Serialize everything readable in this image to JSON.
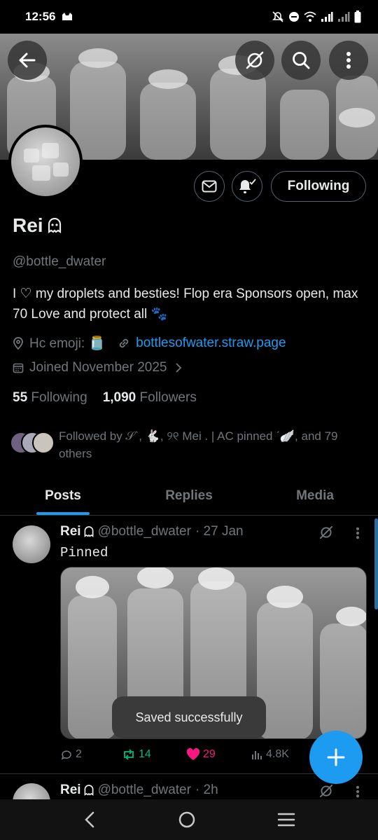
{
  "status_bar": {
    "time": "12:56",
    "icons": [
      "cat-icon",
      "mute-icon",
      "dnd-icon",
      "wifi-icon",
      "signal-icon",
      "signal-icon",
      "battery-icon"
    ]
  },
  "header": {
    "back_icon": "arrow-left-icon",
    "grok_icon": "grok-icon",
    "search_icon": "search-icon",
    "more_icon": "more-vertical-icon"
  },
  "profile": {
    "name": "Rei",
    "name_emoji": "ghost-icon",
    "handle": "@bottle_dwater",
    "bio": "I ♡ my droplets and besties!  Flop era Sponsors open, max 70  Love and protect all 🐾",
    "hc_emoji_label": "Hc emoji: 🫙",
    "link": "bottlesofwater.straw.page",
    "joined": "Joined November 2025",
    "following_count": "55",
    "following_label": "Following",
    "followers_count": "1,090",
    "followers_label": "Followers",
    "followed_by": "Followed by 𝒮ˋ, 🐇, ୨୧ Mei . | AC pinned ˊ🪽, and 79 others",
    "follow_button": "Following"
  },
  "tabs": [
    {
      "label": "Posts",
      "active": true
    },
    {
      "label": "Replies",
      "active": false
    },
    {
      "label": "Media",
      "active": false
    }
  ],
  "posts": [
    {
      "name": "Rei",
      "handle": "@bottle_dwater",
      "time": "· 27 Jan",
      "text": "Pinned",
      "replies": "2",
      "reposts": "14",
      "likes": "29",
      "views": "4.8K"
    },
    {
      "name": "Rei",
      "handle": "@bottle_dwater",
      "time": "· 2h"
    }
  ],
  "toast": "Saved successfully",
  "colors": {
    "accent": "#1d9bf0",
    "repost": "#00ba7c",
    "like": "#f91880",
    "muted": "#71767b"
  }
}
